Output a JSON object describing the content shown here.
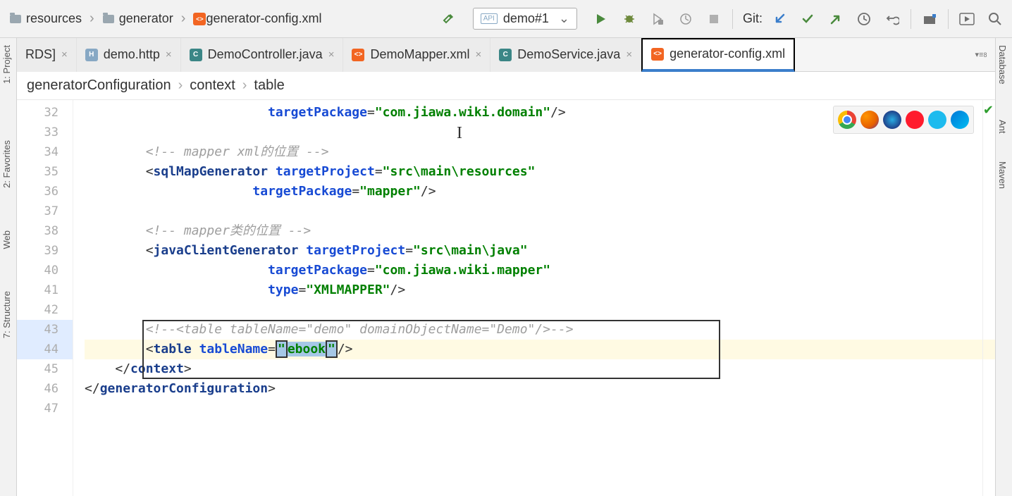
{
  "topBreadcrumb": {
    "items": [
      "resources",
      "generator",
      "generator-config.xml"
    ]
  },
  "runConfig": {
    "name": "demo#1"
  },
  "gitLabel": "Git:",
  "tabs": [
    {
      "label": "RDS]",
      "icon": "http"
    },
    {
      "label": "demo.http",
      "icon": "http"
    },
    {
      "label": "DemoController.java",
      "icon": "java"
    },
    {
      "label": "DemoMapper.xml",
      "icon": "xml"
    },
    {
      "label": "DemoService.java",
      "icon": "java"
    },
    {
      "label": "generator-config.xml",
      "icon": "xml",
      "active": true
    }
  ],
  "navCrumbs": [
    "generatorConfiguration",
    "context",
    "table"
  ],
  "leftPanels": [
    "1: Project",
    "2: Favorites",
    "Web",
    "7: Structure"
  ],
  "rightPanels": [
    "Database",
    "Ant",
    "Maven"
  ],
  "code": {
    "startLine": 32,
    "lines": [
      {
        "n": 32,
        "indent": "                        ",
        "segs": [
          {
            "t": "attr",
            "v": "targetPackage"
          },
          {
            "t": "pun",
            "v": "="
          },
          {
            "t": "val",
            "v": "\"com.jiawa.wiki.domain\""
          },
          {
            "t": "pun",
            "v": "/>"
          }
        ]
      },
      {
        "n": 33,
        "indent": "",
        "segs": []
      },
      {
        "n": 34,
        "indent": "        ",
        "segs": [
          {
            "t": "cmt",
            "v": "<!-- mapper xml的位置 -->"
          }
        ]
      },
      {
        "n": 35,
        "indent": "        ",
        "segs": [
          {
            "t": "pun",
            "v": "<"
          },
          {
            "t": "tag",
            "v": "sqlMapGenerator "
          },
          {
            "t": "attr",
            "v": "targetProject"
          },
          {
            "t": "pun",
            "v": "="
          },
          {
            "t": "val",
            "v": "\"src\\main\\resources\""
          }
        ]
      },
      {
        "n": 36,
        "indent": "                      ",
        "segs": [
          {
            "t": "attr",
            "v": "targetPackage"
          },
          {
            "t": "pun",
            "v": "="
          },
          {
            "t": "val",
            "v": "\"mapper\""
          },
          {
            "t": "pun",
            "v": "/>"
          }
        ]
      },
      {
        "n": 37,
        "indent": "",
        "segs": []
      },
      {
        "n": 38,
        "indent": "        ",
        "segs": [
          {
            "t": "cmt",
            "v": "<!-- mapper类的位置 -->"
          }
        ]
      },
      {
        "n": 39,
        "indent": "        ",
        "segs": [
          {
            "t": "pun",
            "v": "<"
          },
          {
            "t": "tag",
            "v": "javaClientGenerator "
          },
          {
            "t": "attr",
            "v": "targetProject"
          },
          {
            "t": "pun",
            "v": "="
          },
          {
            "t": "val",
            "v": "\"src\\main\\java\""
          }
        ]
      },
      {
        "n": 40,
        "indent": "                        ",
        "segs": [
          {
            "t": "attr",
            "v": "targetPackage"
          },
          {
            "t": "pun",
            "v": "="
          },
          {
            "t": "val",
            "v": "\"com.jiawa.wiki.mapper\""
          }
        ]
      },
      {
        "n": 41,
        "indent": "                        ",
        "segs": [
          {
            "t": "attr",
            "v": "type"
          },
          {
            "t": "pun",
            "v": "="
          },
          {
            "t": "val",
            "v": "\"XMLMAPPER\""
          },
          {
            "t": "pun",
            "v": "/>"
          }
        ]
      },
      {
        "n": 42,
        "indent": "",
        "segs": []
      },
      {
        "n": 43,
        "indent": "        ",
        "segs": [
          {
            "t": "cmt",
            "v": "<!--<table tableName=\"demo\" domainObjectName=\"Demo\"/>-->"
          }
        ],
        "gutterHl": true
      },
      {
        "n": 44,
        "indent": "        ",
        "segs": [
          {
            "t": "pun",
            "v": "<"
          },
          {
            "t": "tag",
            "v": "table "
          },
          {
            "t": "attr",
            "v": "tableName"
          },
          {
            "t": "pun",
            "v": "="
          },
          {
            "t": "selq",
            "v": "\""
          },
          {
            "t": "sel",
            "v": "ebook"
          },
          {
            "t": "selq",
            "v": "\""
          },
          {
            "t": "pun",
            "v": "/>"
          }
        ],
        "current": true,
        "gutterHl": true
      },
      {
        "n": 45,
        "indent": "    ",
        "segs": [
          {
            "t": "pun",
            "v": "</"
          },
          {
            "t": "tag",
            "v": "context"
          },
          {
            "t": "pun",
            "v": ">"
          }
        ]
      },
      {
        "n": 46,
        "indent": "",
        "segs": [
          {
            "t": "pun",
            "v": "</"
          },
          {
            "t": "tag",
            "v": "generatorConfiguration"
          },
          {
            "t": "pun",
            "v": ">"
          }
        ]
      },
      {
        "n": 47,
        "indent": "",
        "segs": []
      }
    ]
  },
  "browserIcons": [
    "chrome",
    "firefox",
    "safari",
    "opera",
    "ie",
    "edge"
  ]
}
